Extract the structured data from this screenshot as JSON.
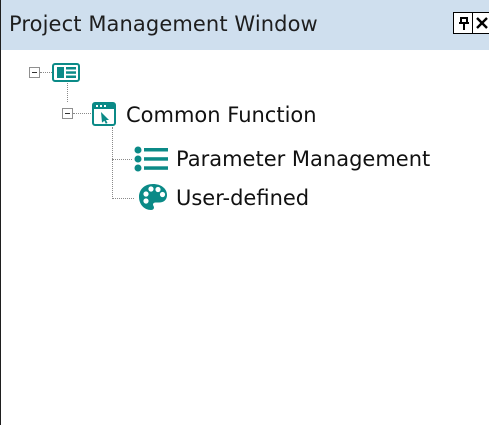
{
  "window": {
    "title": "Project Management Window",
    "buttons": {
      "pin": "ᵾ",
      "close": "×"
    }
  },
  "tree": {
    "root": {
      "icon": "device-icon"
    },
    "common_function": {
      "label": "Common Function",
      "icon": "window-cursor-icon"
    },
    "children": [
      {
        "label": "Parameter Management",
        "icon": "list-icon"
      },
      {
        "label": "User-defined",
        "icon": "palette-icon"
      }
    ]
  },
  "colors": {
    "titlebar_bg": "#cfdfee",
    "icon_teal": "#0b8a87"
  }
}
